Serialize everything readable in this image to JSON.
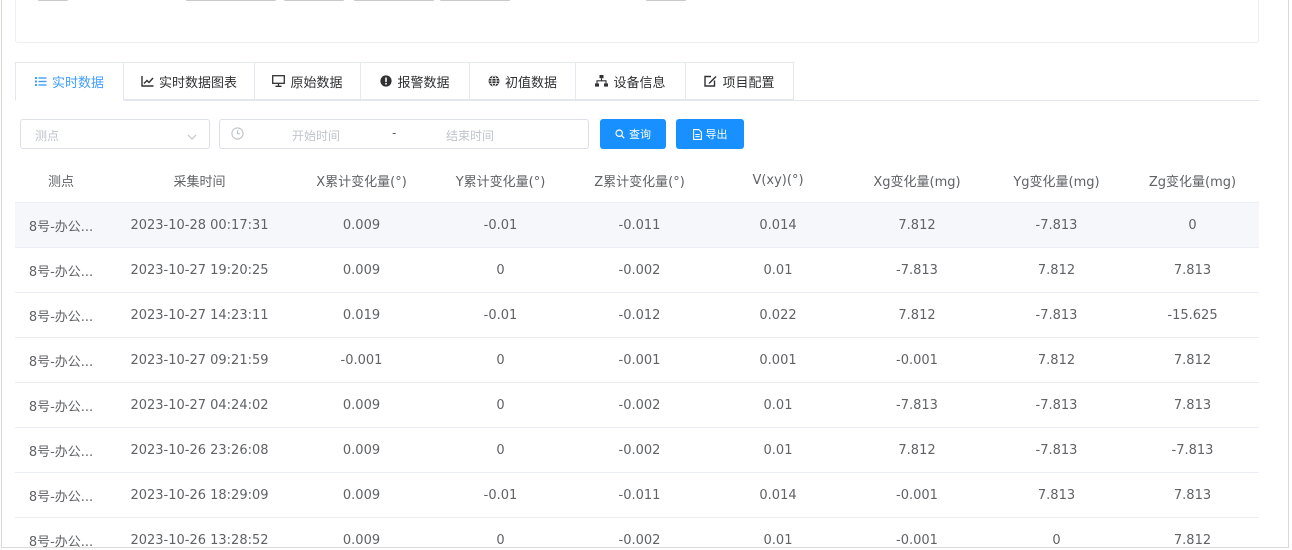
{
  "tabs": [
    {
      "label": "实时数据",
      "icon": "list-icon",
      "active": true
    },
    {
      "label": "实时数据图表",
      "icon": "line-chart-icon",
      "active": false
    },
    {
      "label": "原始数据",
      "icon": "monitor-icon",
      "active": false
    },
    {
      "label": "报警数据",
      "icon": "alert-circle-icon",
      "active": false
    },
    {
      "label": "初值数据",
      "icon": "globe-icon",
      "active": false
    },
    {
      "label": "设备信息",
      "icon": "sitemap-icon",
      "active": false
    },
    {
      "label": "项目配置",
      "icon": "edit-icon",
      "active": false
    }
  ],
  "filters": {
    "point_placeholder": "测点",
    "start_placeholder": "开始时间",
    "range_separator": "-",
    "end_placeholder": "结束时间",
    "query_label": "查询",
    "export_label": "导出"
  },
  "colors": {
    "accent": "#409eff",
    "button": "#1890ff",
    "row_highlight": "#f5f7fa"
  },
  "table": {
    "columns": [
      "测点",
      "采集时间",
      "X累计变化量(°)",
      "Y累计变化量(°)",
      "Z累计变化量(°)",
      "V(xy)(°)",
      "Xg变化量(mg)",
      "Yg变化量(mg)",
      "Zg变化量(mg)"
    ],
    "rows": [
      [
        "8号-办公...",
        "2023-10-28 00:17:31",
        "0.009",
        "-0.01",
        "-0.011",
        "0.014",
        "7.812",
        "-7.813",
        "0"
      ],
      [
        "8号-办公...",
        "2023-10-27 19:20:25",
        "0.009",
        "0",
        "-0.002",
        "0.01",
        "-7.813",
        "7.812",
        "7.813"
      ],
      [
        "8号-办公...",
        "2023-10-27 14:23:11",
        "0.019",
        "-0.01",
        "-0.012",
        "0.022",
        "7.812",
        "-7.813",
        "-15.625"
      ],
      [
        "8号-办公...",
        "2023-10-27 09:21:59",
        "-0.001",
        "0",
        "-0.001",
        "0.001",
        "-0.001",
        "7.812",
        "7.812"
      ],
      [
        "8号-办公...",
        "2023-10-27 04:24:02",
        "0.009",
        "0",
        "-0.002",
        "0.01",
        "-7.813",
        "-7.813",
        "7.813"
      ],
      [
        "8号-办公...",
        "2023-10-26 23:26:08",
        "0.009",
        "0",
        "-0.002",
        "0.01",
        "7.812",
        "-7.813",
        "-7.813"
      ],
      [
        "8号-办公...",
        "2023-10-26 18:29:09",
        "0.009",
        "-0.01",
        "-0.011",
        "0.014",
        "-0.001",
        "7.813",
        "7.813"
      ],
      [
        "8号-办公...",
        "2023-10-26 13:28:52",
        "0.009",
        "0",
        "-0.002",
        "0.01",
        "-0.001",
        "0",
        "7.812"
      ]
    ]
  }
}
